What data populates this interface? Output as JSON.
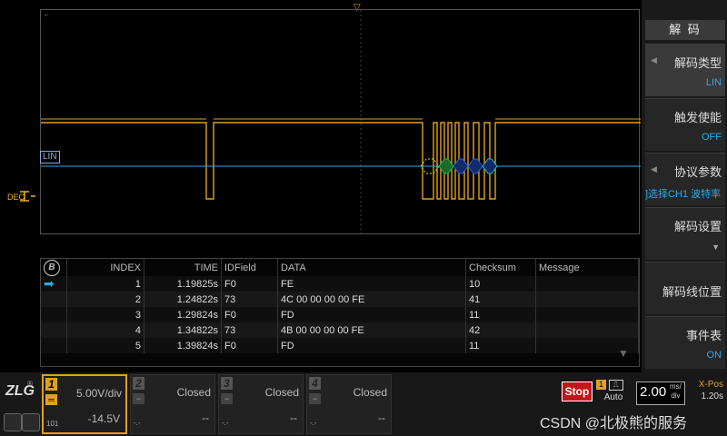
{
  "scope": {
    "lin_label": "LIN",
    "dec_label": "DEC"
  },
  "table": {
    "headers": [
      "INDEX",
      "TIME",
      "IDField",
      "DATA",
      "Checksum",
      "Message"
    ],
    "rows": [
      {
        "index": "1",
        "time": "1.19825s",
        "id": "F0",
        "data": "FE",
        "checksum": "10",
        "message": ""
      },
      {
        "index": "2",
        "time": "1.24822s",
        "id": "73",
        "data": "4C 00 00 00 00 FE",
        "checksum": "41",
        "message": ""
      },
      {
        "index": "3",
        "time": "1.29824s",
        "id": "F0",
        "data": "FD",
        "checksum": "11",
        "message": ""
      },
      {
        "index": "4",
        "time": "1.34822s",
        "id": "73",
        "data": "4B 00 00 00 00 FE",
        "checksum": "42",
        "message": ""
      },
      {
        "index": "5",
        "time": "1.39824s",
        "id": "F0",
        "data": "FD",
        "checksum": "11",
        "message": ""
      }
    ]
  },
  "menu": {
    "title": "解 码",
    "items": [
      {
        "label": "解码类型",
        "value": "LIN"
      },
      {
        "label": "触发使能",
        "value": "OFF"
      },
      {
        "label": "协议参数",
        "value": "]选择CH1 波特率"
      },
      {
        "label": "解码设置",
        "value": ""
      },
      {
        "label": "解码线位置",
        "value": ""
      },
      {
        "label": "事件表",
        "value": "ON"
      }
    ]
  },
  "channels": [
    {
      "num": "1",
      "scale": "5.00V/div",
      "offset": "-14.5V",
      "tag": "101"
    },
    {
      "num": "2",
      "scale": "Closed",
      "offset": "--",
      "tag": "-.-"
    },
    {
      "num": "3",
      "scale": "Closed",
      "offset": "--",
      "tag": "-.-"
    },
    {
      "num": "4",
      "scale": "Closed",
      "offset": "--",
      "tag": "-.-"
    }
  ],
  "status": {
    "run_state": "Stop",
    "trigger_source": "1",
    "trigger_mode": "Auto",
    "timebase_value": "2.00",
    "timebase_unit_top": "ms/",
    "timebase_unit_bottom": "div",
    "xpos_label": "X-Pos",
    "xpos_value": "1.20s"
  },
  "watermark": "CSDN @北极熊的服务",
  "logo": "ZLG",
  "colors": {
    "waveform": "#e0a020",
    "decode_line": "#2fa8e6",
    "accent": "#e0a020",
    "stop": "#c01818"
  }
}
